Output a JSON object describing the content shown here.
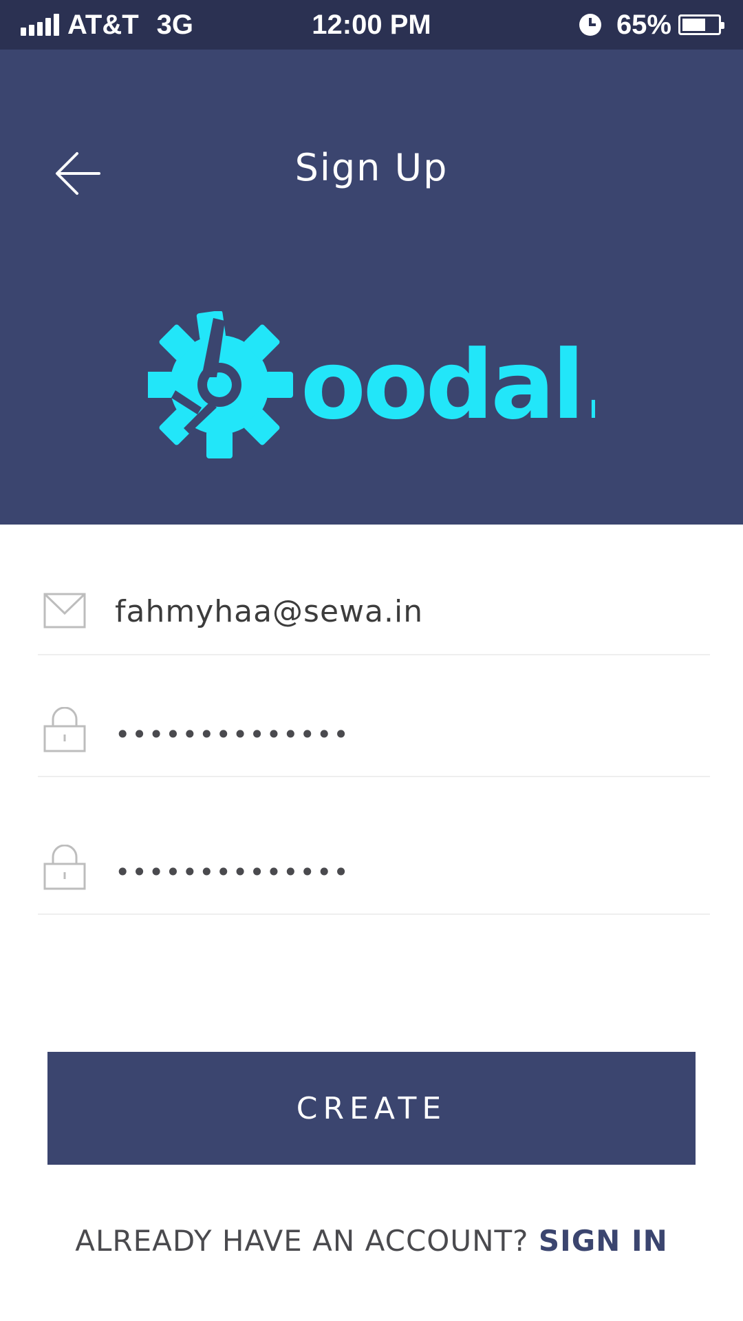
{
  "status_bar": {
    "carrier": "AT&T",
    "network": "3G",
    "time": "12:00 PM",
    "battery_percent": "65%",
    "battery_level": 0.65,
    "signal_bars": 5
  },
  "header": {
    "title": "Sign Up",
    "back_icon": "arrow-left-icon",
    "logo_text": "oodal.",
    "logo_mark": "gear-icon"
  },
  "form": {
    "email": {
      "icon": "mail-icon",
      "value": "fahmyhaa@sewa.in"
    },
    "password": {
      "icon": "lock-icon",
      "value": "••••••••••••••"
    },
    "confirm_password": {
      "icon": "lock-icon",
      "value": "••••••••••••••"
    }
  },
  "create_button": {
    "label": "CREATE"
  },
  "signin_prompt": {
    "text": "ALREADY HAVE AN ACCOUNT?",
    "link": "SIGN IN"
  },
  "colors": {
    "status_bar": "#2b3152",
    "primary": "#3b456f",
    "accent": "#22e6f9",
    "divider": "#eeeeee",
    "text": "#4a4a4e"
  }
}
